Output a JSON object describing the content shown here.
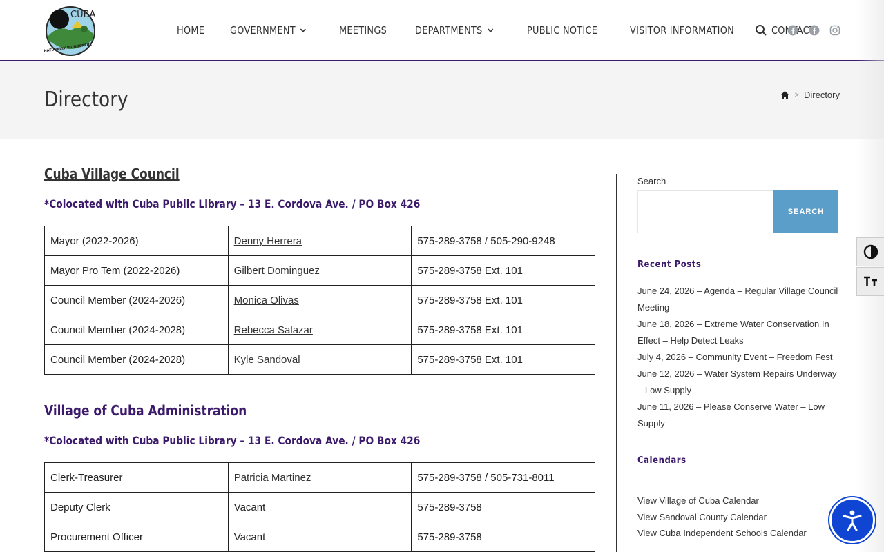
{
  "header": {
    "logo": {
      "text_top": "CUBA",
      "text_ring": "NATURALLY WONDERFUL"
    },
    "nav": [
      {
        "label": "HOME",
        "has_dropdown": false
      },
      {
        "label": "GOVERNMENT",
        "has_dropdown": true
      },
      {
        "label": "MEETINGS",
        "has_dropdown": false
      },
      {
        "label": "DEPARTMENTS",
        "has_dropdown": true
      },
      {
        "label": "PUBLIC NOTICE",
        "has_dropdown": false
      },
      {
        "label": "VISITOR INFORMATION",
        "has_dropdown": false
      },
      {
        "label": "CONTACT",
        "has_dropdown": false
      }
    ],
    "icons": [
      "search-icon",
      "facebook-icon",
      "facebook-icon",
      "instagram-icon"
    ],
    "accent_color": "#3b1a6b"
  },
  "title_bar": {
    "title": "Directory",
    "breadcrumb": {
      "home_icon": "home-icon",
      "separator": ">",
      "current": "Directory"
    }
  },
  "council": {
    "heading": "Cuba Village Council",
    "note": "*Colocated with Cuba Public Library – 13 E. Cordova Ave. / PO Box 426",
    "rows": [
      {
        "role": "Mayor (2022-2026)",
        "name": "Denny Herrera",
        "phone": "575-289-3758 / 505-290-9248",
        "linked": true
      },
      {
        "role": "Mayor Pro Tem (2022-2026)",
        "name": "Gilbert Dominguez",
        "phone": "575-289-3758 Ext. 101",
        "linked": true
      },
      {
        "role": "Council Member (2024-2026)",
        "name": "Monica Olivas",
        "phone": "575-289-3758 Ext. 101",
        "linked": true
      },
      {
        "role": "Council Member (2024-2028)",
        "name": "Rebecca Salazar",
        "phone": "575-289-3758 Ext. 101",
        "linked": true
      },
      {
        "role": "Council Member (2024-2028)",
        "name": "Kyle Sandoval",
        "phone": "575-289-3758 Ext. 101",
        "linked": true
      }
    ]
  },
  "administration": {
    "heading": "Village of Cuba Administration",
    "note": "*Colocated with Cuba Public Library – 13 E. Cordova Ave. / PO Box 426",
    "rows": [
      {
        "role": "Clerk-Treasurer",
        "name": "Patricia Martinez",
        "phone": "575-289-3758 / 505-731-8011",
        "linked": true
      },
      {
        "role": "Deputy Clerk",
        "name": "Vacant",
        "phone": "575-289-3758",
        "linked": false
      },
      {
        "role": "Procurement Officer",
        "name": "Vacant",
        "phone": "575-289-3758",
        "linked": false
      }
    ]
  },
  "sidebar": {
    "search_label": "Search",
    "search_button": "SEARCH",
    "search_value": "",
    "recent_heading": "Recent Posts",
    "posts": [
      "June 24, 2026 – Agenda – Regular Village Council Meeting",
      "June 18, 2026 – Extreme Water Conservation In Effect – Help Detect Leaks",
      "July 4, 2026 – Community Event – Freedom Fest",
      "June 12, 2026 – Water System Repairs Underway – Low Supply",
      "June 11, 2026 – Please Conserve Water – Low Supply"
    ],
    "calendars_heading": "Calendars",
    "calendars": [
      "View Village of Cuba Calendar",
      "View Sandoval County Calendar",
      "View Cuba Independent Schools Calendar"
    ]
  },
  "tools": {
    "contrast_icon": "contrast-toggle-icon",
    "font_icon": "font-size-icon",
    "accessibility_icon": "accessibility-icon",
    "accessibility_color": "#1045d3"
  }
}
